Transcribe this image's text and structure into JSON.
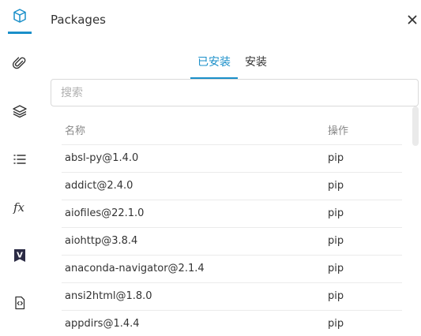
{
  "panel": {
    "title": "Packages"
  },
  "tabs": [
    {
      "label": "已安装",
      "active": true
    },
    {
      "label": "安装",
      "active": false
    }
  ],
  "search": {
    "placeholder": "搜索",
    "value": ""
  },
  "table": {
    "headers": {
      "name": "名称",
      "action": "操作"
    },
    "rows": [
      {
        "name": "absl-py@1.4.0",
        "action": "pip"
      },
      {
        "name": "addict@2.4.0",
        "action": "pip"
      },
      {
        "name": "aiofiles@22.1.0",
        "action": "pip"
      },
      {
        "name": "aiohttp@3.8.4",
        "action": "pip"
      },
      {
        "name": "anaconda-navigator@2.1.4",
        "action": "pip"
      },
      {
        "name": "ansi2html@1.8.0",
        "action": "pip"
      },
      {
        "name": "appdirs@1.4.4",
        "action": "pip"
      }
    ]
  },
  "rail": {
    "items": [
      {
        "icon": "cube-icon",
        "active": true
      },
      {
        "icon": "paperclip-icon",
        "active": false
      },
      {
        "icon": "layers-icon",
        "active": false
      },
      {
        "icon": "list-icon",
        "active": false
      },
      {
        "icon": "fx-icon",
        "label": "fx",
        "active": false
      },
      {
        "icon": "v-bookmark-icon",
        "label": "V",
        "active": false
      },
      {
        "icon": "code-file-icon",
        "active": false
      }
    ]
  },
  "colors": {
    "accent": "#1a8fc9",
    "text": "#333333",
    "muted": "#888888"
  }
}
